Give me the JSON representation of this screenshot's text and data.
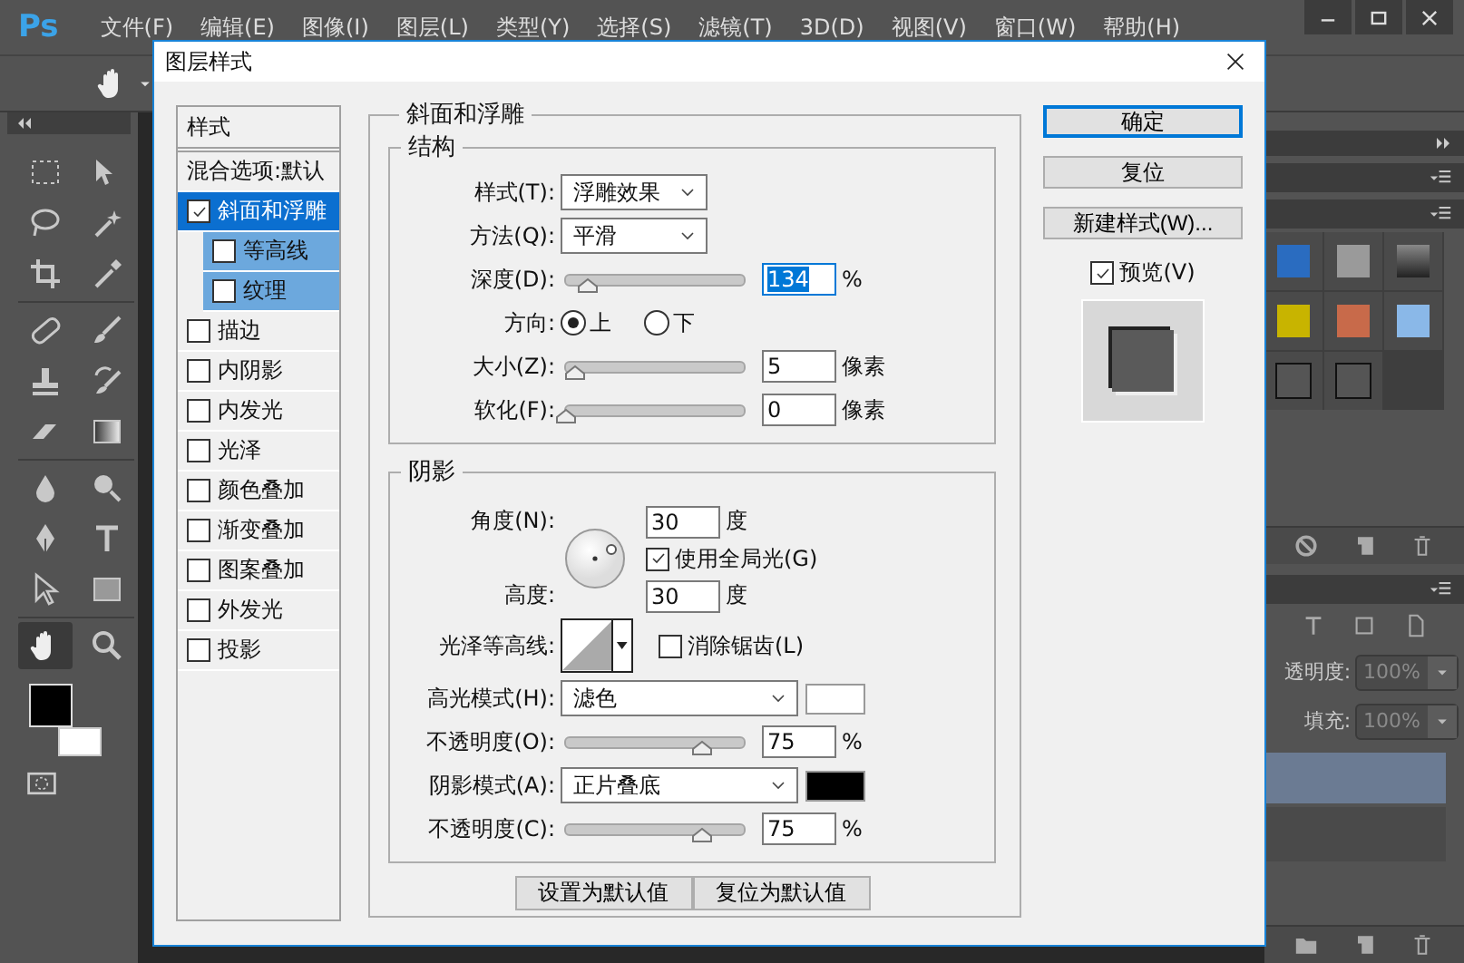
{
  "app": {
    "logo": "Ps",
    "menu": [
      "文件(F)",
      "编辑(E)",
      "图像(I)",
      "图层(L)",
      "类型(Y)",
      "选择(S)",
      "滤镜(T)",
      "3D(D)",
      "视图(V)",
      "窗口(W)",
      "帮助(H)"
    ],
    "layers_panel": {
      "opacity": {
        "label": "透明度:",
        "value": "100%"
      },
      "fill": {
        "label": "填充:",
        "value": "100%"
      }
    }
  },
  "dialog": {
    "title": "图层样式",
    "styles_header": "样式",
    "effects": [
      {
        "label": "混合选项:默认",
        "kind": "plain",
        "selected": false
      },
      {
        "label": "斜面和浮雕",
        "kind": "check",
        "checked": true,
        "selected": true,
        "children": [
          {
            "label": "等高线",
            "kind": "check",
            "checked": false,
            "selected": false
          },
          {
            "label": "纹理",
            "kind": "check",
            "checked": false,
            "selected": false
          }
        ]
      },
      {
        "label": "描边",
        "kind": "check",
        "checked": false,
        "selected": false
      },
      {
        "label": "内阴影",
        "kind": "check",
        "checked": false,
        "selected": false
      },
      {
        "label": "内发光",
        "kind": "check",
        "checked": false,
        "selected": false
      },
      {
        "label": "光泽",
        "kind": "check",
        "checked": false,
        "selected": false
      },
      {
        "label": "颜色叠加",
        "kind": "check",
        "checked": false,
        "selected": false
      },
      {
        "label": "渐变叠加",
        "kind": "check",
        "checked": false,
        "selected": false
      },
      {
        "label": "图案叠加",
        "kind": "check",
        "checked": false,
        "selected": false
      },
      {
        "label": "外发光",
        "kind": "check",
        "checked": false,
        "selected": false
      },
      {
        "label": "投影",
        "kind": "check",
        "checked": false,
        "selected": false
      }
    ],
    "section_title": "斜面和浮雕",
    "structure": {
      "title": "结构",
      "rows": [
        {
          "kind": "select",
          "label": "样式(T):",
          "value": "浮雕效果"
        },
        {
          "kind": "select",
          "label": "方法(Q):",
          "value": "平滑"
        },
        {
          "kind": "slider",
          "label": "深度(D):",
          "level": 0.12,
          "value": "134",
          "unit": "%",
          "focused": true
        },
        {
          "kind": "radio",
          "label": "方向:",
          "options": [
            {
              "label": "上",
              "selected": true
            },
            {
              "label": "下",
              "selected": false
            }
          ]
        },
        {
          "kind": "slider",
          "label": "大小(Z):",
          "level": 0.05,
          "value": "5",
          "unit": "像素",
          "focused": false
        },
        {
          "kind": "slider",
          "label": "软化(F):",
          "level": 0,
          "value": "0",
          "unit": "像素",
          "focused": false
        }
      ]
    },
    "shading": {
      "title": "阴影",
      "angle": {
        "label": "角度(N):",
        "value": "30",
        "unit": "度"
      },
      "global_light": {
        "label": "使用全局光(G)",
        "checked": true
      },
      "altitude": {
        "label": "高度:",
        "value": "30",
        "unit": "度"
      },
      "gloss_contour": {
        "label": "光泽等高线:"
      },
      "anti_alias": {
        "label": "消除锯齿(L)",
        "checked": false
      },
      "rows": [
        {
          "kind": "select",
          "label": "高光模式(H):",
          "value": "滤色",
          "color": "#ffffff"
        },
        {
          "kind": "slider",
          "label": "不透明度(O):",
          "level": 0.77,
          "value": "75",
          "unit": "%",
          "focused": false
        },
        {
          "kind": "select",
          "label": "阴影模式(A):",
          "value": "正片叠底",
          "color": "#000000"
        },
        {
          "kind": "slider",
          "label": "不透明度(C):",
          "level": 0.77,
          "value": "75",
          "unit": "%",
          "focused": false
        }
      ]
    },
    "buttons": [
      "设置为默认值",
      "复位为默认值"
    ],
    "actions": [
      {
        "label": "确定",
        "default": true
      },
      {
        "label": "复位",
        "default": false
      },
      {
        "label": "新建样式(W)...",
        "default": false
      }
    ],
    "preview": {
      "label": "预览(V)",
      "checked": true
    }
  }
}
